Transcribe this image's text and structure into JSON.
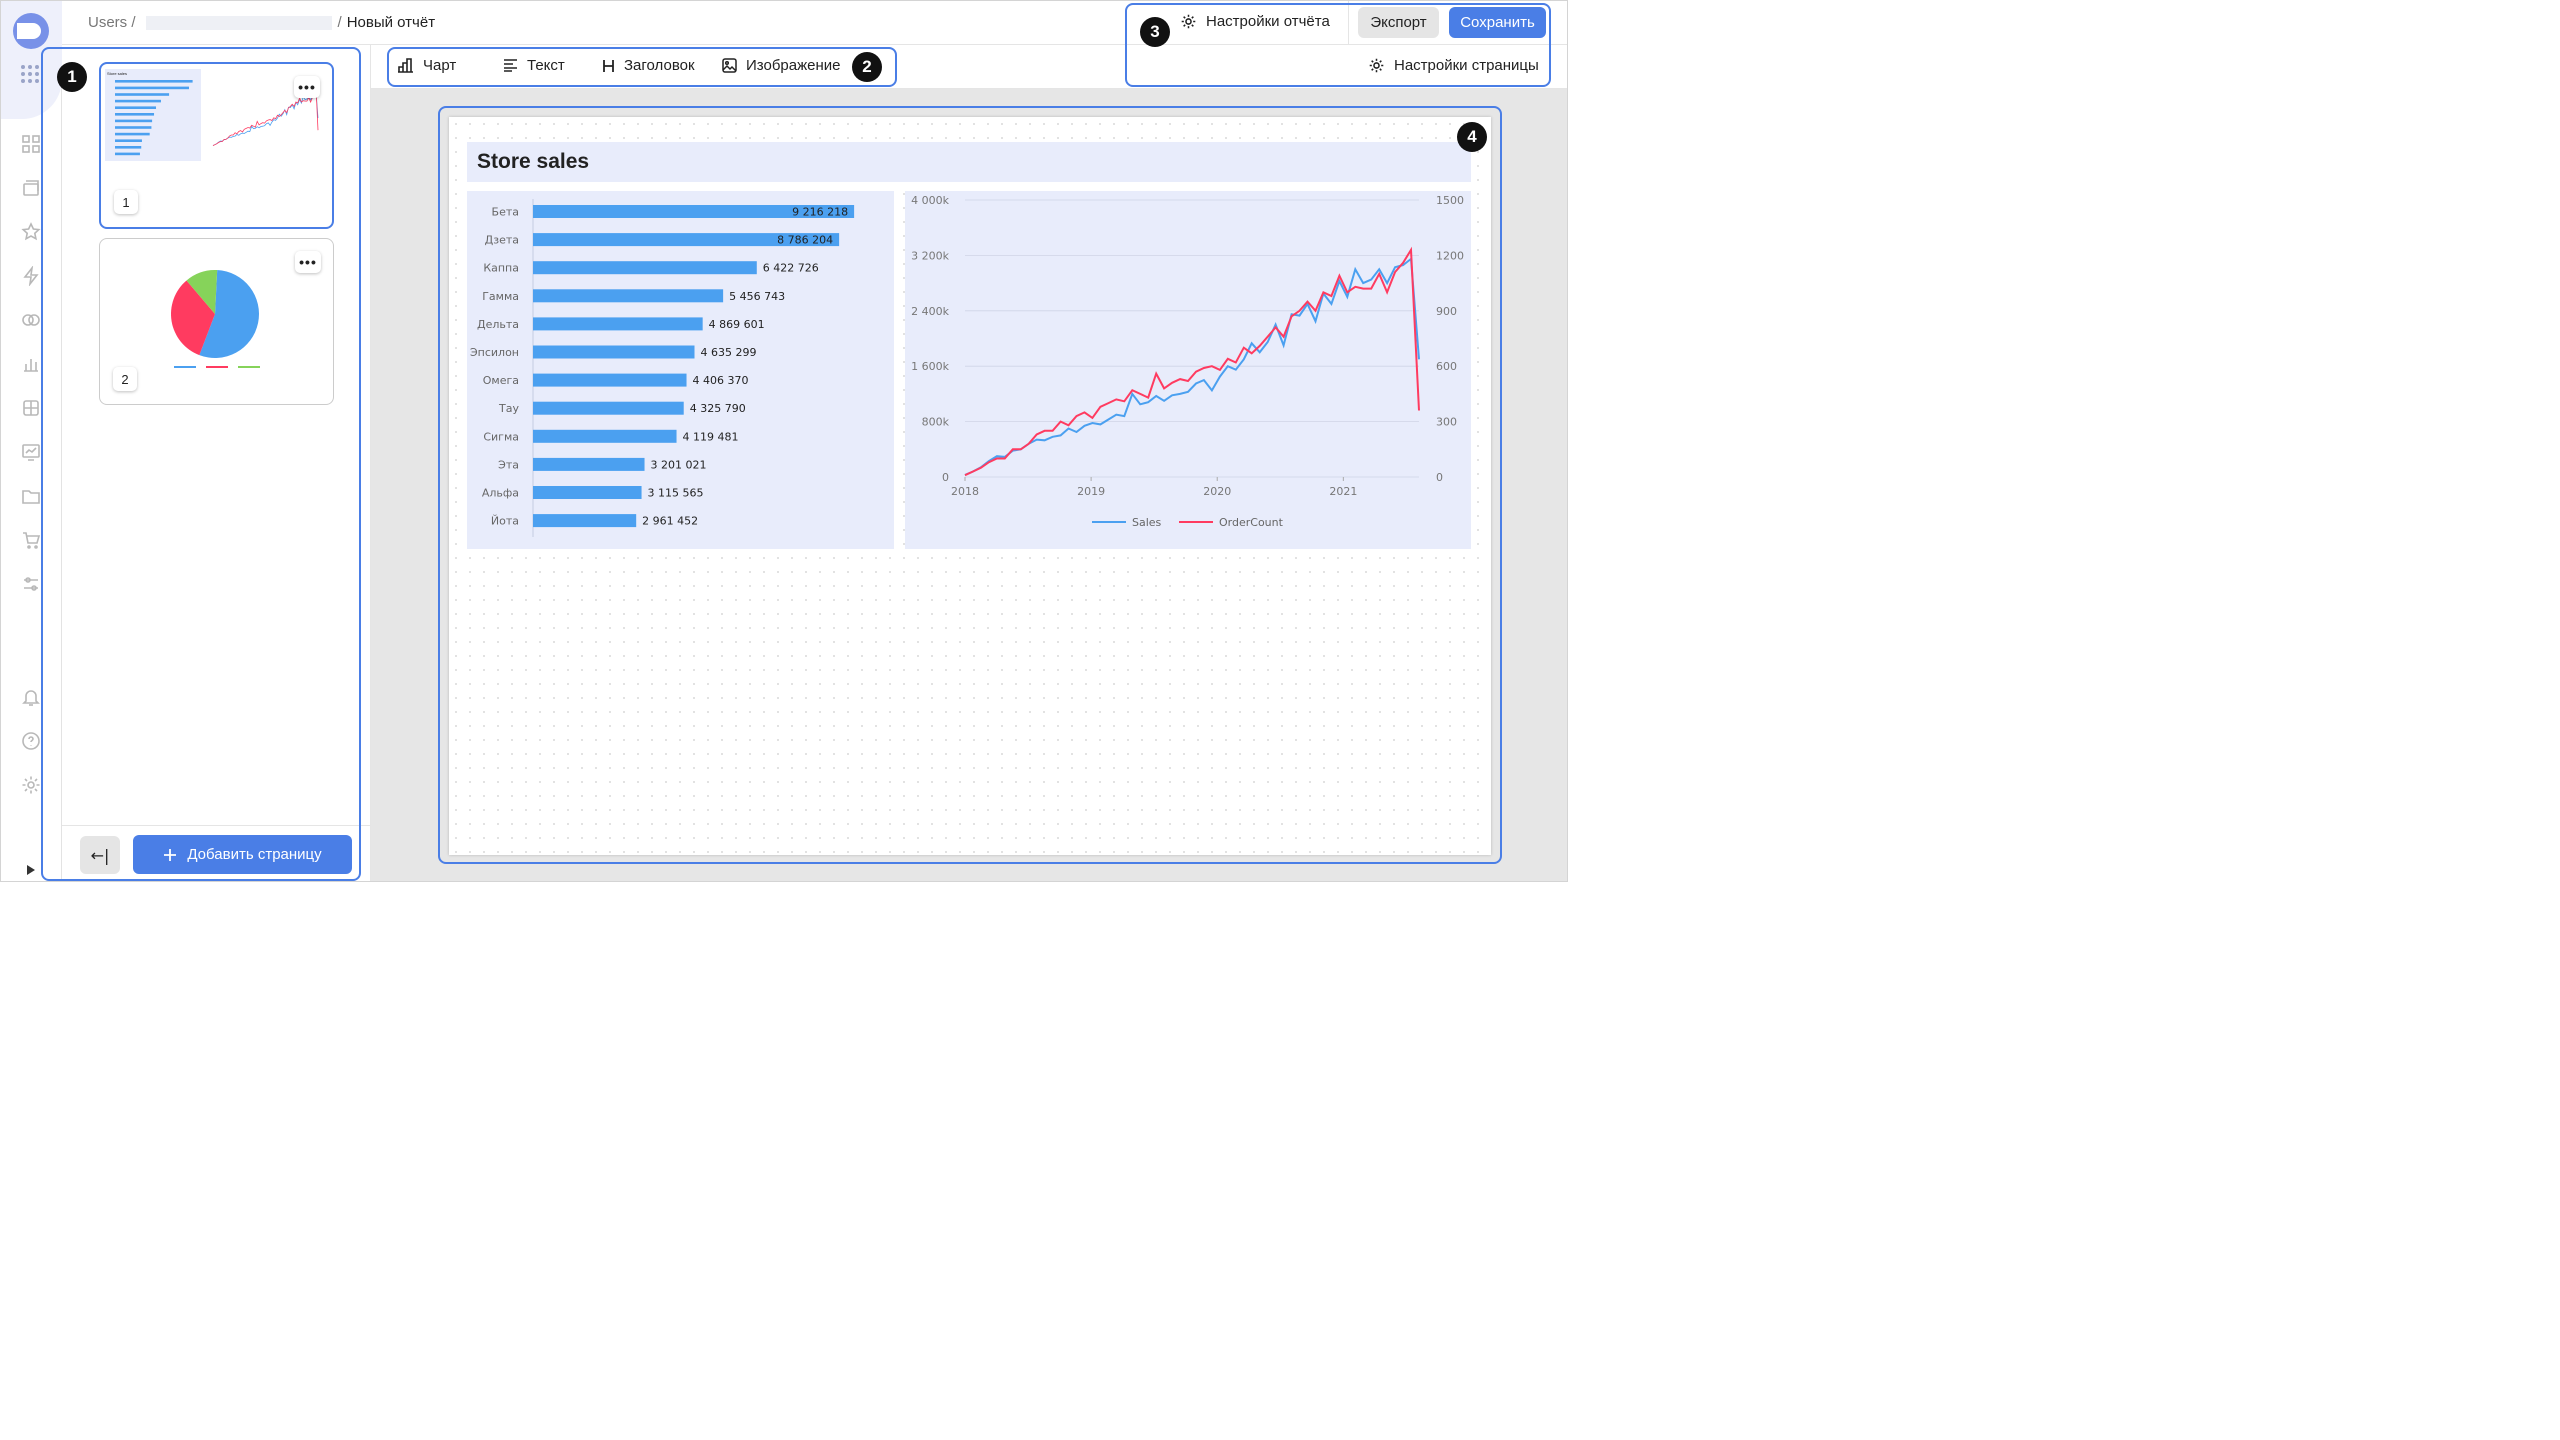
{
  "breadcrumb": {
    "root": "Users /",
    "separator": "/",
    "current": "Новый отчёт"
  },
  "header": {
    "report_settings": "Настройки отчёта",
    "export": "Экспорт",
    "save": "Сохранить"
  },
  "toolbar": {
    "chart": "Чарт",
    "text": "Текст",
    "heading": "Заголовок",
    "image": "Изображение",
    "page_settings": "Настройки страницы"
  },
  "pages": {
    "items": [
      {
        "number": "1"
      },
      {
        "number": "2"
      }
    ],
    "more_label": "•••",
    "collapse_label": "←|",
    "add_page": "Добавить страницу"
  },
  "report": {
    "title": "Store sales"
  },
  "callouts": [
    "1",
    "2",
    "3",
    "4"
  ],
  "colors": {
    "accent": "#4a7ee6",
    "bar": "#4ba0f0",
    "sales": "#4ba0f0",
    "ordercount": "#ff3b60",
    "pie_blue": "#4ba0f0",
    "pie_red": "#ff3b60",
    "pie_green": "#86d35a"
  },
  "chart_data": [
    {
      "type": "bar",
      "orientation": "horizontal",
      "categories": [
        "Бета",
        "Дзета",
        "Каппа",
        "Гамма",
        "Дельта",
        "Эпсилон",
        "Омега",
        "Тау",
        "Сигма",
        "Эта",
        "Альфа",
        "Йота"
      ],
      "values": [
        9216218,
        8786204,
        6422726,
        5456743,
        4869601,
        4635299,
        4406370,
        4325790,
        4119481,
        3201021,
        3115565,
        2961452
      ],
      "value_labels": [
        "9 216 218",
        "8 786 204",
        "6 422 726",
        "5 456 743",
        "4 869 601",
        "4 635 299",
        "4 406 370",
        "4 325 790",
        "4 119 481",
        "3 201 021",
        "3 115 565",
        "2 961 452"
      ],
      "xlim": [
        0,
        9500000
      ]
    },
    {
      "type": "line",
      "x_ticks": [
        "2018",
        "2019",
        "2020",
        "2021"
      ],
      "x_start": 2018.0,
      "x_end": 2021.6,
      "y_ticks": [
        "0",
        "800k",
        "1 600k",
        "2 400k",
        "3 200k",
        "4 000k"
      ],
      "ylim": [
        0,
        4000000
      ],
      "y2_ticks": [
        "0",
        "300",
        "600",
        "900",
        "1200",
        "1500"
      ],
      "y2lim": [
        0,
        1500
      ],
      "legend_position": "bottom",
      "series": [
        {
          "name": "Sales",
          "axis": "left",
          "values": [
            30000,
            80000,
            140000,
            230000,
            300000,
            290000,
            380000,
            400000,
            480000,
            540000,
            530000,
            580000,
            600000,
            700000,
            650000,
            740000,
            780000,
            760000,
            830000,
            900000,
            880000,
            1200000,
            1050000,
            1080000,
            1170000,
            1100000,
            1180000,
            1200000,
            1230000,
            1350000,
            1400000,
            1250000,
            1450000,
            1600000,
            1550000,
            1700000,
            1930000,
            1800000,
            1950000,
            2200000,
            1900000,
            2350000,
            2330000,
            2500000,
            2250000,
            2650000,
            2500000,
            2830000,
            2600000,
            3000000,
            2800000,
            2850000,
            3000000,
            2800000,
            3030000,
            3060000,
            3150000,
            1700000
          ]
        },
        {
          "name": "OrderCount",
          "axis": "right",
          "values": [
            10,
            30,
            50,
            80,
            100,
            100,
            150,
            150,
            180,
            230,
            250,
            250,
            300,
            280,
            330,
            350,
            320,
            380,
            400,
            420,
            410,
            470,
            450,
            430,
            560,
            480,
            510,
            530,
            520,
            570,
            590,
            600,
            580,
            640,
            620,
            700,
            670,
            710,
            760,
            810,
            760,
            870,
            900,
            950,
            900,
            1000,
            980,
            1090,
            1000,
            1030,
            1020,
            1020,
            1100,
            1000,
            1110,
            1160,
            1230,
            360
          ]
        }
      ]
    },
    {
      "type": "pie",
      "slices": [
        {
          "color": "#4ba0f0",
          "value": 0.55
        },
        {
          "color": "#ff3b60",
          "value": 0.33
        },
        {
          "color": "#86d35a",
          "value": 0.12
        }
      ]
    }
  ]
}
